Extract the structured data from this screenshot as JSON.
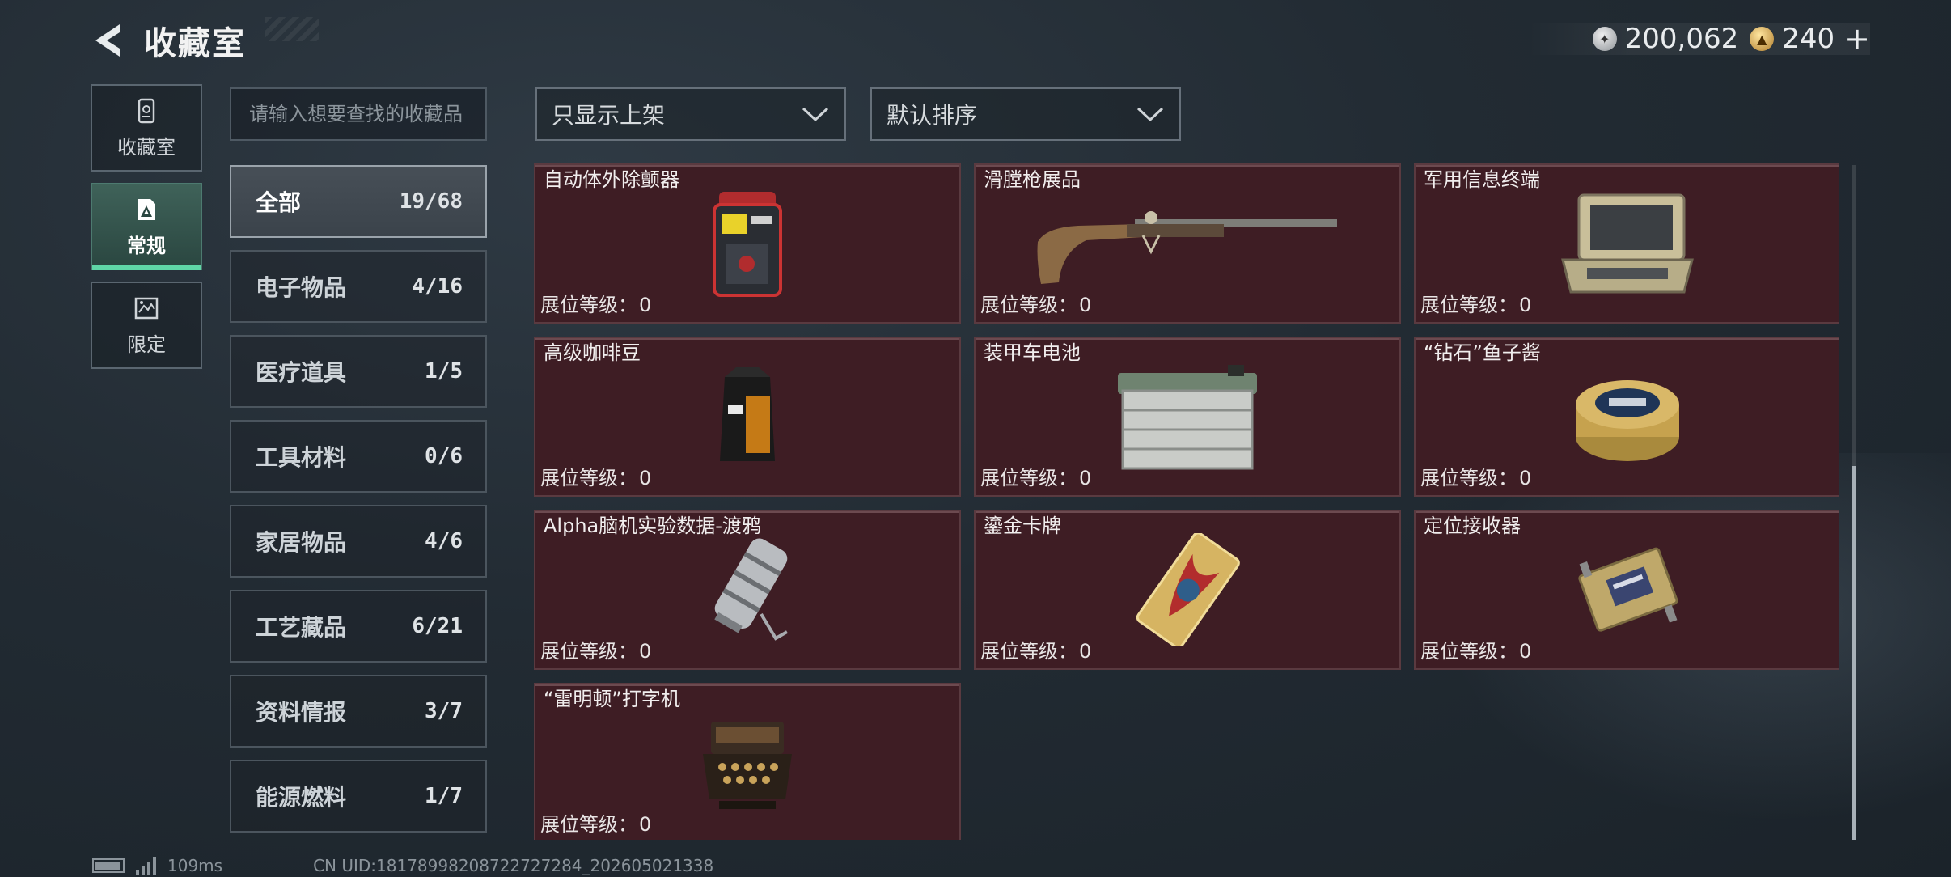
{
  "header": {
    "title": "收藏室",
    "currency": [
      {
        "icon": "silver-coin-icon",
        "value": "200,062"
      },
      {
        "icon": "gold-coin-icon",
        "value": "240"
      }
    ],
    "add_symbol": "+"
  },
  "rail": [
    {
      "label": "收藏室",
      "icon": "archive-icon",
      "active": false
    },
    {
      "label": "常规",
      "icon": "collection-icon",
      "active": true
    },
    {
      "label": "限定",
      "icon": "limited-icon",
      "active": false
    }
  ],
  "search": {
    "placeholder": "请输入想要查找的收藏品",
    "value": ""
  },
  "filters": {
    "display_filter": "只显示上架",
    "sort": "默认排序"
  },
  "categories": [
    {
      "name": "全部",
      "count": "19/68",
      "active": true
    },
    {
      "name": "电子物品",
      "count": "4/16",
      "active": false
    },
    {
      "name": "医疗道具",
      "count": "1/5",
      "active": false
    },
    {
      "name": "工具材料",
      "count": "0/6",
      "active": false
    },
    {
      "name": "家居物品",
      "count": "4/6",
      "active": false
    },
    {
      "name": "工艺藏品",
      "count": "6/21",
      "active": false
    },
    {
      "name": "资料情报",
      "count": "3/7",
      "active": false
    },
    {
      "name": "能源燃料",
      "count": "1/7",
      "active": false
    }
  ],
  "level_label": "展位等级：",
  "items": [
    {
      "name": "自动体外除颤器",
      "level": "0",
      "icon": "defibrillator-icon"
    },
    {
      "name": "滑膛枪展品",
      "level": "0",
      "icon": "musket-icon"
    },
    {
      "name": "军用信息终端",
      "level": "0",
      "icon": "military-terminal-icon"
    },
    {
      "name": "高级咖啡豆",
      "level": "0",
      "icon": "coffee-bag-icon"
    },
    {
      "name": "装甲车电池",
      "level": "0",
      "icon": "battery-icon"
    },
    {
      "name": "“钻石”鱼子酱",
      "level": "0",
      "icon": "caviar-tin-icon"
    },
    {
      "name": "Alpha脑机实验数据-渡鸦",
      "level": "0",
      "icon": "data-canister-icon"
    },
    {
      "name": "鎏金卡牌",
      "level": "0",
      "icon": "gold-card-icon"
    },
    {
      "name": "定位接收器",
      "level": "0",
      "icon": "receiver-icon"
    },
    {
      "name": "“雷明顿”打字机",
      "level": "0",
      "icon": "typewriter-icon"
    }
  ],
  "footer": {
    "latency": "109ms",
    "uid": "CN UID:18178998208722727284_202605021338"
  },
  "colors": {
    "card_bg": "#3e1d24",
    "active_rail": "#3f6259",
    "accent": "#5fd6a6"
  }
}
